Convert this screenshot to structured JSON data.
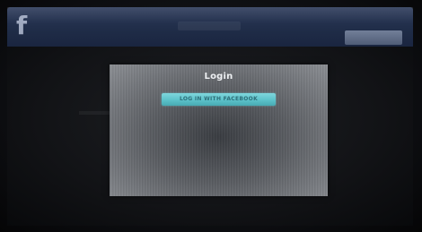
{
  "app": {
    "logo_icon": "facebook-f-logo-icon"
  },
  "modal": {
    "title": "Login",
    "login_button_label": "LOG IN WITH FACEBOOK"
  }
}
